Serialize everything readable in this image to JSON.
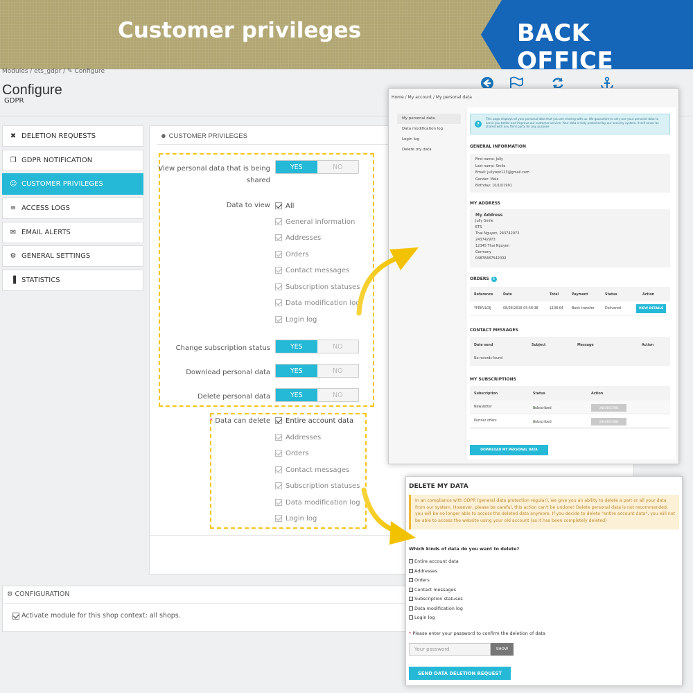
{
  "banner": {
    "title": "Customer privileges",
    "badge": "BACK OFFICE",
    "bg_color": "#b1a672",
    "badge_color": "#1565b8"
  },
  "header": {
    "breadcrumb": "Modules  /  ets_gdpr  /  ✎ Configure",
    "title": "Configure",
    "subtitle": "GDPR",
    "toolbar_icons": [
      "back-icon",
      "flag-icon",
      "refresh-icon",
      "anchor-icon"
    ]
  },
  "sidebar": {
    "items": [
      {
        "label": "DELETION REQUESTS",
        "icon": "✖",
        "active": false
      },
      {
        "label": "GDPR NOTIFICATION",
        "icon": "❐",
        "active": false
      },
      {
        "label": "CUSTOMER PRIVILEGES",
        "icon": "☺",
        "active": true
      },
      {
        "label": "ACCESS LOGS",
        "icon": "≡",
        "active": false
      },
      {
        "label": "EMAIL ALERTS",
        "icon": "✉",
        "active": false
      },
      {
        "label": "GENERAL SETTINGS",
        "icon": "⚙",
        "active": false
      },
      {
        "label": "STATISTICS",
        "icon": "▐",
        "active": false
      }
    ],
    "accent_color": "#25b9d7"
  },
  "panel": {
    "title": "CUSTOMER PRIVILEGES",
    "view_label_1": "View personal data that is being",
    "view_label_2": "shared",
    "data_to_view_label": "Data to view",
    "change_sub_label": "Change subscription status",
    "download_label": "Download personal data",
    "delete_label": "Delete personal data",
    "can_delete_label": "Data can delete",
    "yes": "YES",
    "no": "NO",
    "view_options": [
      "All",
      "General information",
      "Addresses",
      "Orders",
      "Contact messages",
      "Subscription statuses",
      "Data modification log",
      "Login log"
    ],
    "delete_options": [
      "Entire account data",
      "Addresses",
      "Orders",
      "Contact messages",
      "Subscription statuses",
      "Data modification log",
      "Login log"
    ]
  },
  "config": {
    "title": "CONFIGURATION",
    "checkbox": "Activate module for this shop context: all shops."
  },
  "front1": {
    "breadcrumb": "Home  /  My account  /  My personal data",
    "nav": [
      "My personal data",
      "Data modification log",
      "Login log",
      "Delete my data"
    ],
    "alert": "This page displays all your personal data that you are sharing with us. We guarantee to only use your personal data to serve you better and improve our customer service. Your data is fully protected by our security system, it will never be shared with any third party for any purpose",
    "general_info_title": "GENERAL INFORMATION",
    "general_info": [
      "First name: Jully",
      "Last name: Smile",
      "Email: jullytest123@gmail.com",
      "Gender: Male",
      "Birthday: 10/10/1991"
    ],
    "address_title": "MY ADDRESS",
    "address_name": "My Address",
    "address_lines": [
      "Jully Smile",
      "ETS",
      "Thai Nguyen, 243742973",
      "243742973",
      "12345 Thai Nguyen",
      "Germany",
      "04878487542002"
    ],
    "orders_title": "ORDERS",
    "orders_headers": [
      "Reference",
      "Date",
      "Total",
      "Payment",
      "Status",
      "Action"
    ],
    "order_row": [
      "YFRKVLOIJ",
      "08/28/2018 05:58:38",
      "$138.64",
      "Bank transfer",
      "Delivered"
    ],
    "view_details": "VIEW DETAILS",
    "contact_title": "CONTACT MESSAGES",
    "contact_headers": [
      "Date send",
      "Subject",
      "Message",
      "Action"
    ],
    "no_records": "No records found",
    "subs_title": "MY SUBSCRIPTIONS",
    "subs_headers": [
      "Subscription",
      "Status",
      "Action"
    ],
    "subs_rows": [
      {
        "name": "Newsletter",
        "status": "Subscribed",
        "action": "UNSUBSCRIBE"
      },
      {
        "name": "Partner offers",
        "status": "Subscribed",
        "action": "UNSUBSCRIBE"
      }
    ],
    "download_btn": "DOWNLOAD MY PERSONAL DATA"
  },
  "front2": {
    "title": "DELETE MY DATA",
    "warning": "In an compliance with GDPR (general data protection regular), we give you an ability to delete a part or all your data from our system. However, please be careful, this action can't be undone! Delete personal data is not recommended, you will be no longer able to access the deleted data anymore. If you decide to delete \"entire account data\", you will not be able to access the website using your old account (as it has been completely deleted)",
    "question": "Which kinds of data do you want to delete?",
    "options": [
      "Entire account data",
      "Addresses",
      "Orders",
      "Contact messages",
      "Subscription statuses",
      "Data modification log",
      "Login log"
    ],
    "password_label": "Please enter your password to confirm the deletion of data",
    "password_placeholder": "Your password",
    "show_btn": "SHOW",
    "send_btn": "SEND DATA DELETION REQUEST"
  },
  "colors": {
    "highlight_dash": "#f5c518",
    "arrow": "#f5c518"
  }
}
